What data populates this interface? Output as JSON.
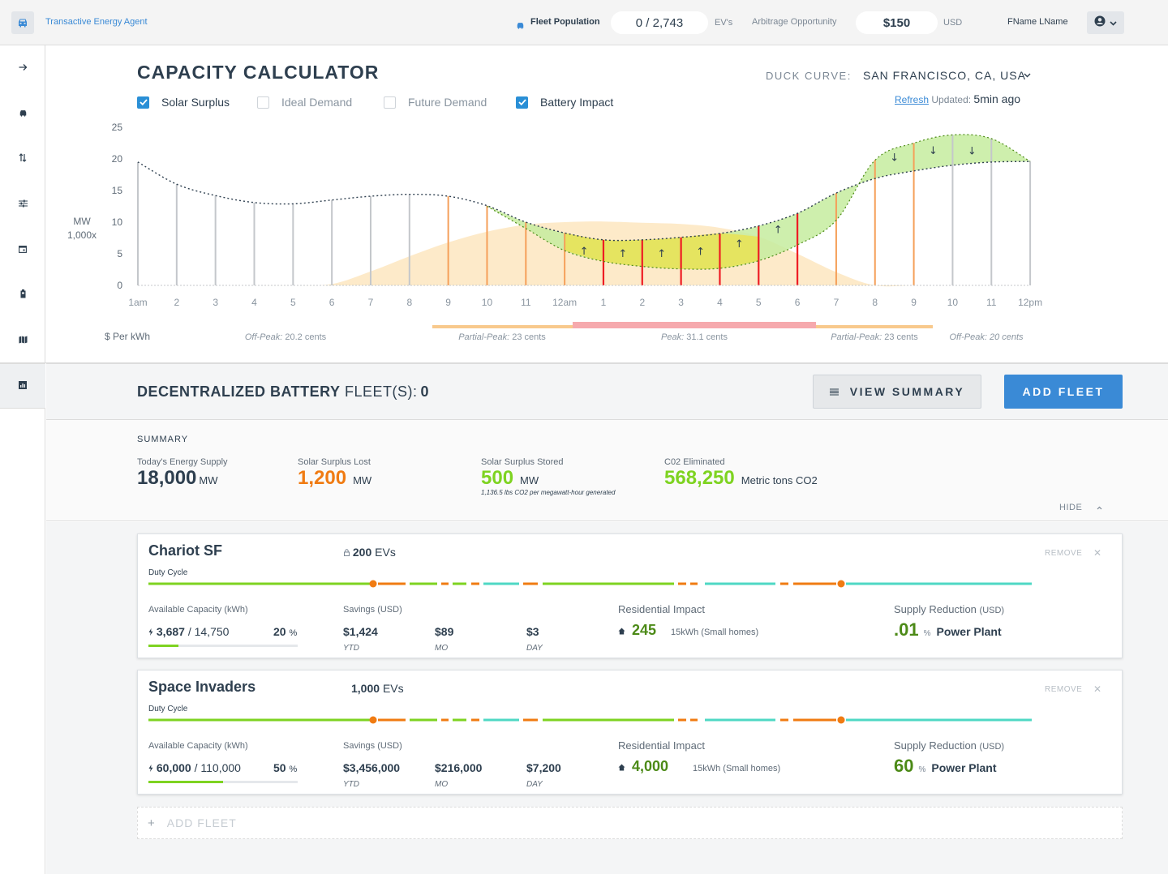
{
  "header": {
    "app_title": "Transactive Energy Agent",
    "fleet_population_label": "Fleet Population",
    "fleet_population_value": "0 / 2,743",
    "fleet_population_unit": "EV's",
    "arbitrage_label": "Arbitrage Opportunity",
    "arbitrage_value": "$150",
    "arbitrage_unit": "USD",
    "user_name": "FName LName"
  },
  "sidebar": {
    "items": [
      {
        "icon": "arrow-right-icon"
      },
      {
        "icon": "car-icon"
      },
      {
        "icon": "transfer-icon"
      },
      {
        "icon": "sliders-icon"
      },
      {
        "icon": "calendar-icon"
      },
      {
        "icon": "battery-icon"
      },
      {
        "icon": "map-icon"
      },
      {
        "icon": "chart-icon",
        "active": true
      }
    ]
  },
  "calculator": {
    "title": "CAPACITY CALCULATOR",
    "duck_curve_label": "DUCK CURVE:",
    "duck_curve_value": "SAN FRANCISCO, CA, USA",
    "refresh_label": "Refresh",
    "updated_label": "Updated:",
    "updated_value": "5min ago",
    "checkboxes": [
      {
        "label": "Solar Surplus",
        "checked": true
      },
      {
        "label": "Ideal Demand",
        "checked": false
      },
      {
        "label": "Future Demand",
        "checked": false
      },
      {
        "label": "Battery Impact",
        "checked": true
      }
    ]
  },
  "chart_data": {
    "type": "area",
    "ylabel": "MW 1,000x",
    "ylim": [
      0,
      25
    ],
    "yticks": [
      0,
      5,
      10,
      15,
      20,
      25
    ],
    "grid": true,
    "x": [
      "1am",
      "2",
      "3",
      "4",
      "5",
      "6",
      "7",
      "8",
      "9",
      "10",
      "11",
      "12am",
      "1",
      "2",
      "3",
      "4",
      "5",
      "6",
      "7",
      "8",
      "9",
      "10",
      "11",
      "12pm"
    ],
    "series": [
      {
        "values": [
          19.5,
          16,
          14.2,
          13.1,
          12.9,
          13.5,
          14.1,
          14.4,
          14.1,
          12.6,
          10,
          8.3,
          7.2,
          7.2,
          7.6,
          8.2,
          9.4,
          11.4,
          14.6,
          16.9,
          18.1,
          19.0,
          19.5,
          19.6
        ]
      },
      {
        "values": [
          null,
          null,
          null,
          null,
          null,
          null,
          null,
          null,
          null,
          12.5,
          9,
          5.5,
          3.8,
          3.0,
          2.6,
          2.7,
          3.9,
          6.4,
          10.3,
          19.8,
          22.5,
          23.8,
          23.2,
          19.6
        ]
      },
      {
        "values": [
          0,
          0,
          0,
          0,
          0,
          0.2,
          2.2,
          4.6,
          6.8,
          8.5,
          9.6,
          10.0,
          10.1,
          9.9,
          9.7,
          9.1,
          7.7,
          5.0,
          2.1,
          0,
          0,
          0,
          0,
          0
        ]
      }
    ],
    "bar_colors": [
      "gray",
      "gray",
      "gray",
      "gray",
      "gray",
      "gray",
      "gray",
      "gray",
      "orange",
      "orange",
      "orange",
      "orange",
      "red",
      "red",
      "red",
      "red",
      "red",
      "red",
      "orange",
      "orange",
      "orange",
      "gray",
      "gray",
      "gray"
    ],
    "arrows": [
      {
        "x": "1",
        "dir": "up"
      },
      {
        "x": "2",
        "dir": "up"
      },
      {
        "x": "3",
        "dir": "up"
      },
      {
        "x": "4",
        "dir": "up"
      },
      {
        "x": "5",
        "dir": "up"
      },
      {
        "x": "6",
        "dir": "up"
      },
      {
        "x": "9",
        "dir": "down"
      },
      {
        "x": "10",
        "dir": "down"
      },
      {
        "x": "11",
        "dir": "down"
      }
    ],
    "price_label": "$ Per  kWh",
    "price_periods": [
      {
        "name": "Off-Peak",
        "value": "20.2 cents"
      },
      {
        "name": "Partial-Peak",
        "value": "23 cents"
      },
      {
        "name": "Peak",
        "value": "31.1 cents"
      },
      {
        "name": "Partial-Peak",
        "value": "23 cents"
      },
      {
        "name": "Off-Peak",
        "value": "20 cents"
      }
    ],
    "colors": {
      "gray": "#c4c7cb",
      "orange": "#f5a05a",
      "red": "#ee1c24",
      "solar": "#fde6bf",
      "battery": "#c6ec9f",
      "overlap": "#ece24a"
    }
  },
  "battery": {
    "title": "DECENTRALIZED BATTERY",
    "fleets_label": "FLEET(S):",
    "fleets_count": "0",
    "view_summary_label": "VIEW SUMMARY",
    "add_fleet_label": "ADD FLEET"
  },
  "summary": {
    "heading": "SUMMARY",
    "stats": [
      {
        "label": "Today's Energy Supply",
        "value": "18,000",
        "unit": "MW",
        "color": "#2e3f4f",
        "note": ""
      },
      {
        "label": "Solar Surplus Lost",
        "value": "1,200",
        "unit": "MW",
        "color": "#f07b12",
        "note": ""
      },
      {
        "label": "Solar Surplus Stored",
        "value": "500",
        "unit": "MW",
        "color": "#7ed321",
        "note": "1,136.5 lbs CO2 per megawatt-hour generated"
      },
      {
        "label": "C02 Eliminated",
        "value": "568,250",
        "unit": "Metric tons CO2",
        "color": "#7ed321",
        "note": ""
      }
    ],
    "hide_label": "HIDE"
  },
  "fleets": [
    {
      "name": "Chariot SF",
      "evs_count": "200",
      "evs_unit": "EVs",
      "remove_label": "REMOVE",
      "duty_label": "Duty Cycle",
      "capacity_label": "Available Capacity (kWh)",
      "capacity_value": "3,687",
      "capacity_total": "/ 14,750",
      "capacity_pct": "20",
      "capacity_fraction": 0.2,
      "savings_label": "Savings (USD)",
      "savings_ytd": "$1,424",
      "savings_mo": "$89",
      "savings_day": "$3",
      "ytd_label": "YTD",
      "mo_label": "MO",
      "day_label": "DAY",
      "res_label": "Residential Impact",
      "res_value": "245",
      "res_unit": "15kWh (Small homes)",
      "supply_label": "Supply Reduction",
      "supply_unit_label": "(USD)",
      "supply_value": ".01",
      "supply_pct": "%",
      "supply_target": "Power Plant"
    },
    {
      "name": "Space Invaders",
      "evs_count": "1,000",
      "evs_unit": "EVs",
      "remove_label": "REMOVE",
      "duty_label": "Duty Cycle",
      "capacity_label": "Available Capacity (kWh)",
      "capacity_value": "60,000",
      "capacity_total": "/ 110,000",
      "capacity_pct": "50",
      "capacity_fraction": 0.5,
      "savings_label": "Savings (USD)",
      "savings_ytd": "$3,456,000",
      "savings_mo": "$216,000",
      "savings_day": "$7,200",
      "ytd_label": "YTD",
      "mo_label": "MO",
      "day_label": "DAY",
      "res_label": "Residential Impact",
      "res_value": "4,000",
      "res_unit": "15kWh (Small homes)",
      "supply_label": "Supply Reduction",
      "supply_unit_label": "(USD)",
      "supply_value": "60",
      "supply_pct": "%",
      "supply_target": "Power Plant"
    }
  ],
  "add_fleet_row": {
    "label": "ADD FLEET"
  }
}
